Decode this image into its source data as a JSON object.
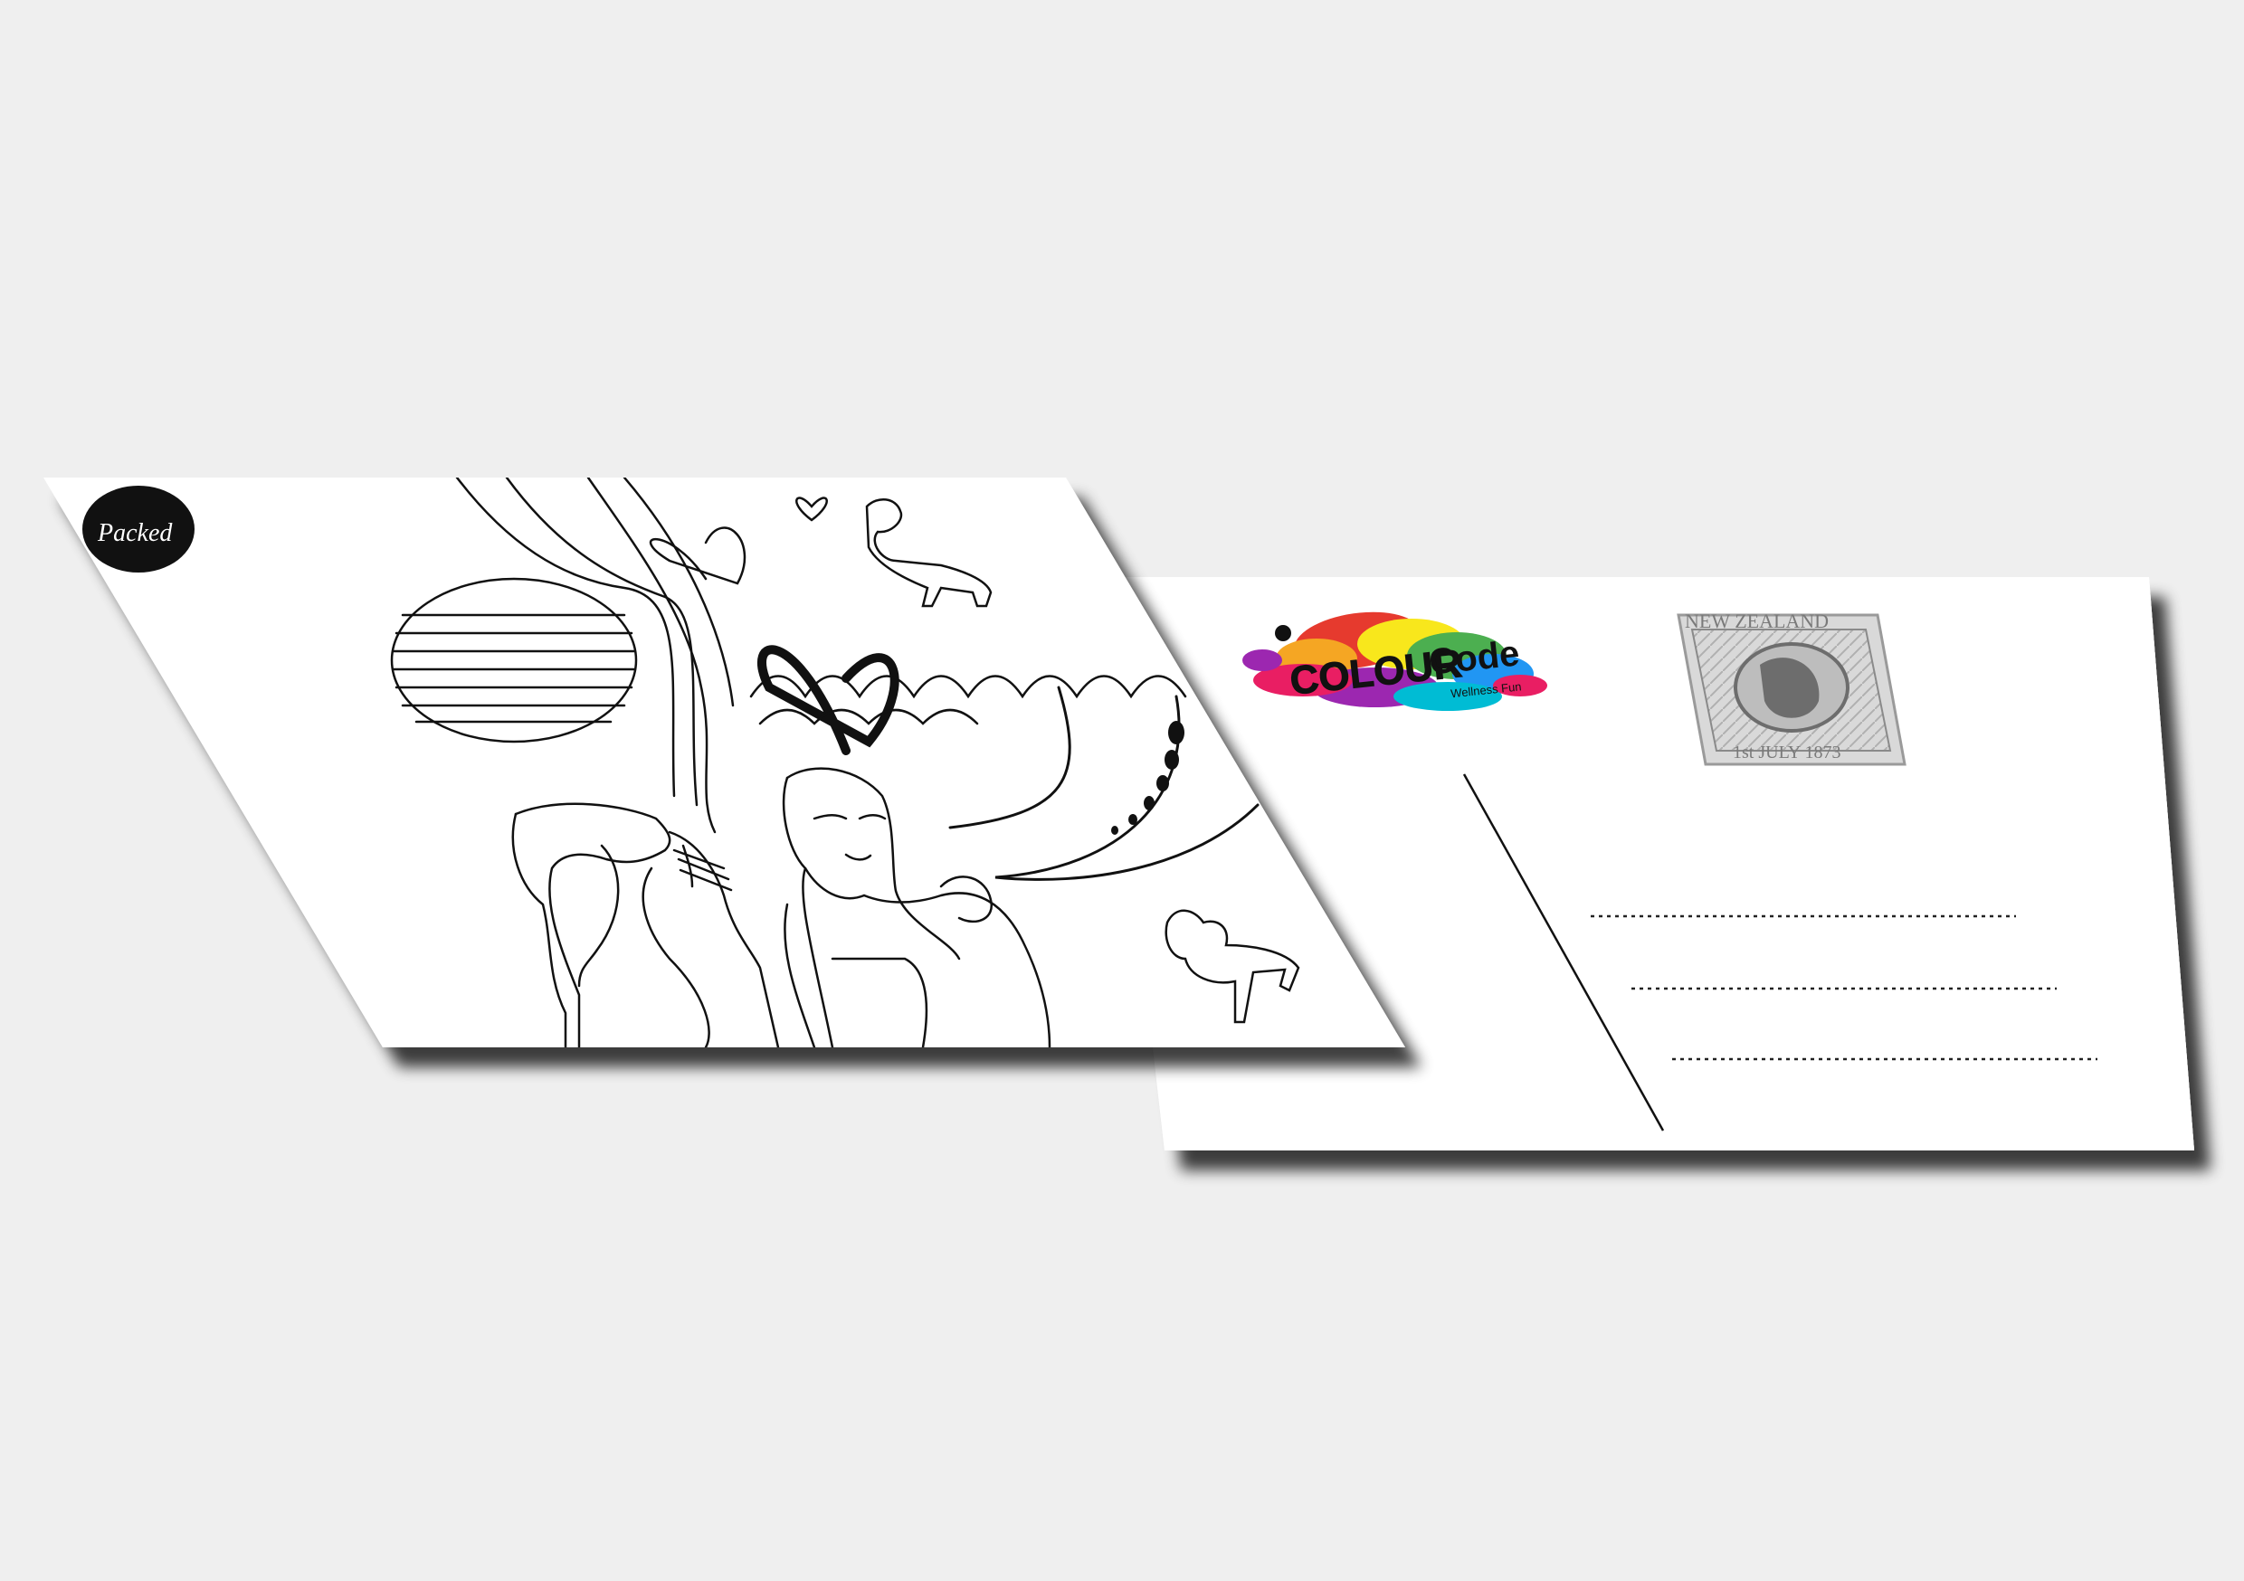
{
  "front_card": {
    "badge_text": "Packed"
  },
  "back_card": {
    "logo_words": [
      "COLOUR",
      "Code"
    ],
    "logo_tagline": "Wellness Fun",
    "stamp": {
      "country": "NEW ZEALAND",
      "date": "1st JULY 1873"
    },
    "address_lines": 3
  },
  "colors": {
    "background": "#efefef",
    "card": "#ffffff",
    "ink": "#111111",
    "stamp_gray": "#9a9a9a",
    "logo_splash": [
      "#e63a2e",
      "#f5a623",
      "#f8e71c",
      "#4caf50",
      "#2196f3",
      "#9c27b0",
      "#e91e63",
      "#00bcd4"
    ]
  }
}
